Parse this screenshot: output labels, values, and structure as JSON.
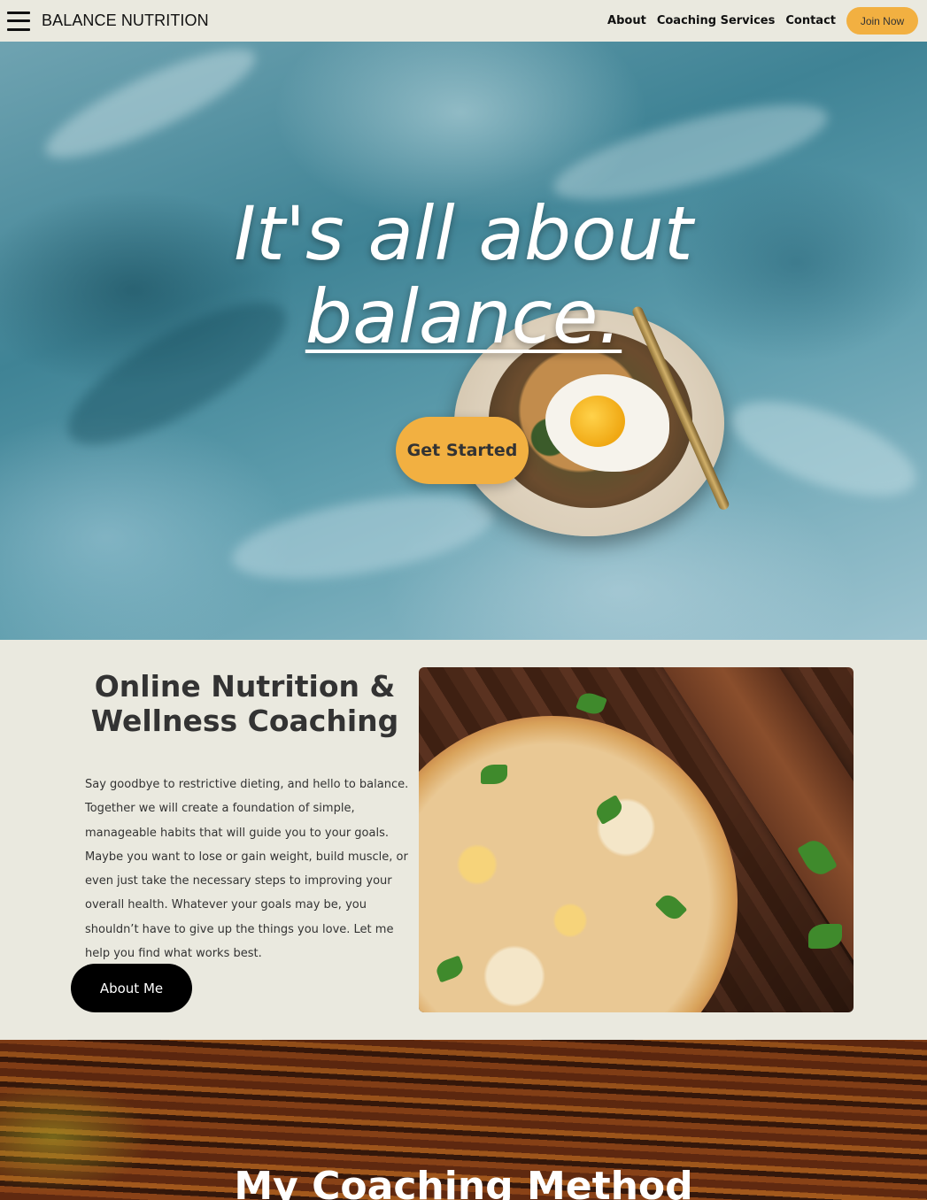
{
  "nav": {
    "brand": "BALANCE NUTRITION",
    "links": [
      "About",
      "Coaching Services",
      "Contact"
    ],
    "cta": "Join Now"
  },
  "hero": {
    "title_line1": "It's all about",
    "title_line2": "balance.",
    "button": "Get Started"
  },
  "coaching": {
    "heading": "Online Nutrition & Wellness Coaching",
    "body": "Say goodbye to restrictive dieting, and hello to balance. Together we will create a foundation of simple, manageable habits that will guide you to your goals. Maybe you want to lose or gain weight, build muscle, or even just take the necessary steps to improving your overall health. Whatever your goals may be, you shouldn’t have to give up the things you love. Let me help you find what works best.",
    "button": "About Me"
  },
  "method": {
    "title": "My Coaching Method"
  },
  "colors": {
    "accent": "#f2b041",
    "background": "#eae9df",
    "text": "#333333",
    "dark_button": "#000000"
  },
  "icons": {
    "menu": "hamburger-menu-icon"
  }
}
